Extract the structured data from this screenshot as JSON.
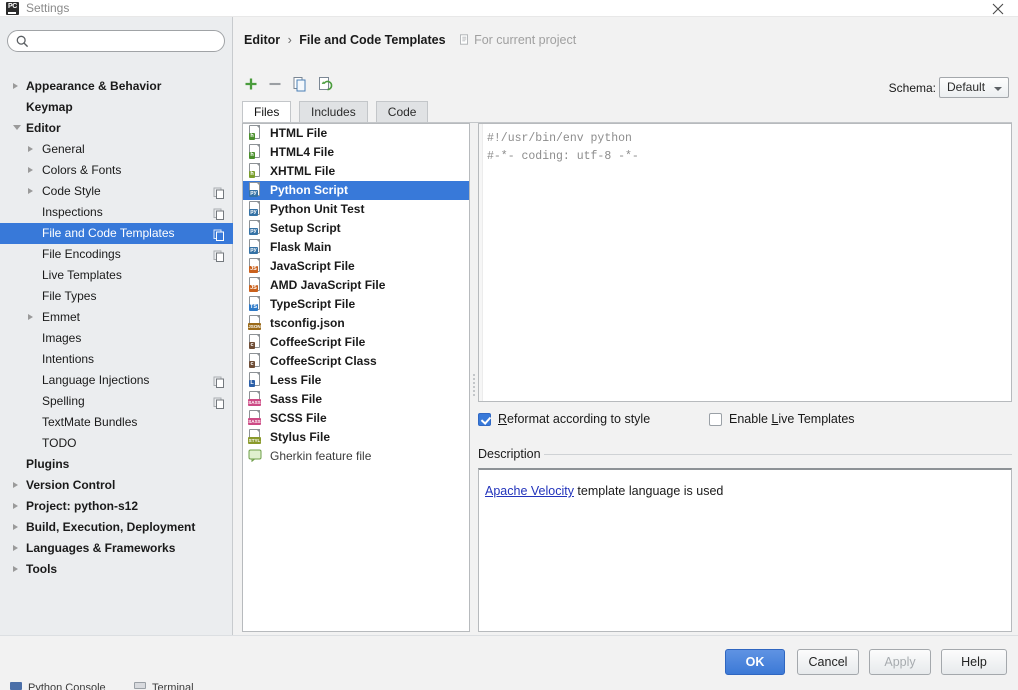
{
  "window": {
    "title": "Settings",
    "app_icon": "pycharm-icon",
    "close_icon": "close-icon"
  },
  "sidebar": {
    "search": {
      "value": "",
      "placeholder": "",
      "icon": "search-icon"
    },
    "items": [
      {
        "label": "Appearance & Behavior",
        "depth": 0,
        "bold": true,
        "arrow": "closed",
        "copy": false,
        "selected": false
      },
      {
        "label": "Keymap",
        "depth": 0,
        "bold": true,
        "arrow": "none",
        "copy": false,
        "selected": false
      },
      {
        "label": "Editor",
        "depth": 0,
        "bold": true,
        "arrow": "open",
        "copy": false,
        "selected": false
      },
      {
        "label": "General",
        "depth": 1,
        "bold": false,
        "arrow": "closed",
        "copy": false,
        "selected": false
      },
      {
        "label": "Colors & Fonts",
        "depth": 1,
        "bold": false,
        "arrow": "closed",
        "copy": false,
        "selected": false
      },
      {
        "label": "Code Style",
        "depth": 1,
        "bold": false,
        "arrow": "closed",
        "copy": true,
        "selected": false
      },
      {
        "label": "Inspections",
        "depth": 1,
        "bold": false,
        "arrow": "none",
        "copy": true,
        "selected": false
      },
      {
        "label": "File and Code Templates",
        "depth": 1,
        "bold": false,
        "arrow": "none",
        "copy": true,
        "selected": true
      },
      {
        "label": "File Encodings",
        "depth": 1,
        "bold": false,
        "arrow": "none",
        "copy": true,
        "selected": false
      },
      {
        "label": "Live Templates",
        "depth": 1,
        "bold": false,
        "arrow": "none",
        "copy": false,
        "selected": false
      },
      {
        "label": "File Types",
        "depth": 1,
        "bold": false,
        "arrow": "none",
        "copy": false,
        "selected": false
      },
      {
        "label": "Emmet",
        "depth": 1,
        "bold": false,
        "arrow": "closed",
        "copy": false,
        "selected": false
      },
      {
        "label": "Images",
        "depth": 1,
        "bold": false,
        "arrow": "none",
        "copy": false,
        "selected": false
      },
      {
        "label": "Intentions",
        "depth": 1,
        "bold": false,
        "arrow": "none",
        "copy": false,
        "selected": false
      },
      {
        "label": "Language Injections",
        "depth": 1,
        "bold": false,
        "arrow": "none",
        "copy": true,
        "selected": false
      },
      {
        "label": "Spelling",
        "depth": 1,
        "bold": false,
        "arrow": "none",
        "copy": true,
        "selected": false
      },
      {
        "label": "TextMate Bundles",
        "depth": 1,
        "bold": false,
        "arrow": "none",
        "copy": false,
        "selected": false
      },
      {
        "label": "TODO",
        "depth": 1,
        "bold": false,
        "arrow": "none",
        "copy": false,
        "selected": false
      },
      {
        "label": "Plugins",
        "depth": 0,
        "bold": true,
        "arrow": "none",
        "copy": false,
        "selected": false
      },
      {
        "label": "Version Control",
        "depth": 0,
        "bold": true,
        "arrow": "closed",
        "copy": false,
        "selected": false
      },
      {
        "label": "Project: python-s12",
        "depth": 0,
        "bold": true,
        "arrow": "closed",
        "copy": false,
        "selected": false
      },
      {
        "label": "Build, Execution, Deployment",
        "depth": 0,
        "bold": true,
        "arrow": "closed",
        "copy": false,
        "selected": false
      },
      {
        "label": "Languages & Frameworks",
        "depth": 0,
        "bold": true,
        "arrow": "closed",
        "copy": false,
        "selected": false
      },
      {
        "label": "Tools",
        "depth": 0,
        "bold": true,
        "arrow": "closed",
        "copy": false,
        "selected": false
      }
    ]
  },
  "content": {
    "breadcrumb": {
      "parent": "Editor",
      "separator": "›",
      "current": "File and Code Templates",
      "scope": "For current project",
      "scope_icon": "project-scope-icon"
    },
    "toolbar": [
      {
        "name": "add-template-button",
        "icon": "plus-icon"
      },
      {
        "name": "remove-template-button",
        "icon": "minus-icon"
      },
      {
        "name": "copy-template-button",
        "icon": "copy-icon"
      },
      {
        "name": "reset-template-button",
        "icon": "reset-icon"
      }
    ],
    "schema": {
      "label": "Schema:",
      "value": "Default"
    },
    "tabs": [
      {
        "label": "Files",
        "active": true
      },
      {
        "label": "Includes",
        "active": false
      },
      {
        "label": "Code",
        "active": false
      }
    ],
    "templates": [
      {
        "label": "HTML File",
        "icon": "html-file-icon",
        "badge": "h",
        "badge_color": "#4a8f2c",
        "selected": false,
        "plain": false
      },
      {
        "label": "HTML4 File",
        "icon": "html4-file-icon",
        "badge": "h",
        "badge_color": "#4a8f2c",
        "selected": false,
        "plain": false
      },
      {
        "label": "XHTML File",
        "icon": "xhtml-file-icon",
        "badge": "h",
        "badge_color": "#7a9f2c",
        "selected": false,
        "plain": false
      },
      {
        "label": "Python Script",
        "icon": "python-file-icon",
        "badge": "py",
        "badge_color": "#3572a5",
        "selected": true,
        "plain": false
      },
      {
        "label": "Python Unit Test",
        "icon": "python-file-icon",
        "badge": "py",
        "badge_color": "#3572a5",
        "selected": false,
        "plain": false
      },
      {
        "label": "Setup Script",
        "icon": "python-file-icon",
        "badge": "py",
        "badge_color": "#3572a5",
        "selected": false,
        "plain": false
      },
      {
        "label": "Flask Main",
        "icon": "python-file-icon",
        "badge": "py",
        "badge_color": "#3572a5",
        "selected": false,
        "plain": false
      },
      {
        "label": "JavaScript File",
        "icon": "javascript-file-icon",
        "badge": "JS",
        "badge_color": "#c9601c",
        "selected": false,
        "plain": false
      },
      {
        "label": "AMD JavaScript File",
        "icon": "javascript-file-icon",
        "badge": "JS",
        "badge_color": "#c9601c",
        "selected": false,
        "plain": false
      },
      {
        "label": "TypeScript File",
        "icon": "typescript-file-icon",
        "badge": "TS",
        "badge_color": "#2d79c7",
        "selected": false,
        "plain": false
      },
      {
        "label": "tsconfig.json",
        "icon": "json-file-icon",
        "badge": "JSON",
        "badge_color": "#9a6a1a",
        "selected": false,
        "plain": false
      },
      {
        "label": "CoffeeScript File",
        "icon": "coffeescript-file-icon",
        "badge": "c",
        "badge_color": "#6f4e37",
        "selected": false,
        "plain": false
      },
      {
        "label": "CoffeeScript Class",
        "icon": "coffeescript-file-icon",
        "badge": "c",
        "badge_color": "#6f4e37",
        "selected": false,
        "plain": false
      },
      {
        "label": "Less File",
        "icon": "less-file-icon",
        "badge": "L",
        "badge_color": "#2b5fa8",
        "selected": false,
        "plain": false
      },
      {
        "label": "Sass File",
        "icon": "sass-file-icon",
        "badge": "SASS",
        "badge_color": "#cd4a85",
        "selected": false,
        "plain": false
      },
      {
        "label": "SCSS File",
        "icon": "scss-file-icon",
        "badge": "SASS",
        "badge_color": "#cd4a85",
        "selected": false,
        "plain": false
      },
      {
        "label": "Stylus File",
        "icon": "stylus-file-icon",
        "badge": "STYL",
        "badge_color": "#8a9a2b",
        "selected": false,
        "plain": false
      },
      {
        "label": "Gherkin feature file",
        "icon": "gherkin-file-icon",
        "badge": "",
        "badge_color": "#6f9f4a",
        "selected": false,
        "plain": true
      }
    ],
    "editor": {
      "code": "#!/usr/bin/env python\n#-*- coding: utf-8 -*-"
    },
    "options": {
      "reformat": {
        "label": "Reformat according to style",
        "mnemonic": "R",
        "checked": true
      },
      "live_templates": {
        "label": "Enable Live Templates",
        "mnemonic": "L",
        "checked": false
      }
    },
    "description": {
      "title": "Description",
      "link": "Apache Velocity",
      "rest": " template language is used"
    }
  },
  "buttons": {
    "ok": "OK",
    "cancel": "Cancel",
    "apply": "Apply",
    "help": "Help"
  },
  "bottom_strip": {
    "python_console": "Python Console",
    "terminal": "Terminal"
  }
}
